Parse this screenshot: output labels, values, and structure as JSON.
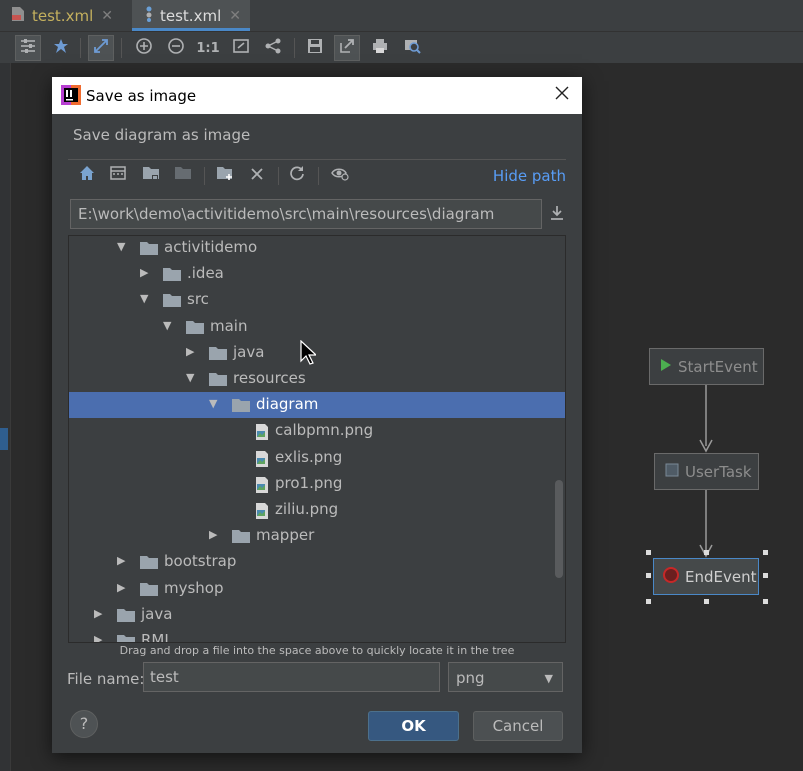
{
  "tabs": [
    {
      "label": "test.xml",
      "active": false
    },
    {
      "label": "test.xml",
      "active": true
    }
  ],
  "toolbar": {
    "icons": [
      "settings-icon",
      "pin-icon",
      "fit-icon",
      "zoom-in-icon",
      "zoom-out-icon",
      "actual-size-icon",
      "zoom-region-icon",
      "share-icon",
      "save-icon",
      "export-icon",
      "print-icon",
      "inspect-icon"
    ],
    "actual_size_label": "1:1"
  },
  "diagram": {
    "nodes": [
      {
        "label": "StartEvent"
      },
      {
        "label": "UserTask"
      },
      {
        "label": "EndEvent"
      }
    ],
    "colors": {
      "start": "#4caf50",
      "end": "#c62828"
    }
  },
  "dialog": {
    "title": "Save as image",
    "subtitle": "Save diagram as image",
    "hide_path_label": "Hide path",
    "path_value": "E:\\work\\demo\\activitidemo\\src\\main\\resources\\diagram",
    "tree": [
      {
        "label": "activitidemo",
        "expanded": true,
        "type": "folder"
      },
      {
        "label": ".idea",
        "expanded": false,
        "type": "folder"
      },
      {
        "label": "src",
        "expanded": true,
        "type": "folder"
      },
      {
        "label": "main",
        "expanded": true,
        "type": "folder"
      },
      {
        "label": "java",
        "expanded": false,
        "type": "folder"
      },
      {
        "label": "resources",
        "expanded": true,
        "type": "folder"
      },
      {
        "label": "diagram",
        "expanded": true,
        "type": "folder",
        "selected": true
      },
      {
        "label": "calbpmn.png",
        "type": "file"
      },
      {
        "label": "exlis.png",
        "type": "file"
      },
      {
        "label": "pro1.png",
        "type": "file"
      },
      {
        "label": "ziliu.png",
        "type": "file"
      },
      {
        "label": "mapper",
        "expanded": false,
        "type": "folder"
      },
      {
        "label": "bootstrap",
        "expanded": false,
        "type": "folder"
      },
      {
        "label": "myshop",
        "expanded": false,
        "type": "folder"
      },
      {
        "label": "java",
        "expanded": false,
        "type": "folder"
      },
      {
        "label": "RMI",
        "expanded": false,
        "type": "folder"
      }
    ],
    "hint": "Drag and drop a file into the space above to quickly locate it in the tree",
    "file_name_label": "File name:",
    "file_name_value": "test",
    "format_value": "png",
    "ok_label": "OK",
    "cancel_label": "Cancel",
    "help_label": "?"
  },
  "colors": {
    "accent": "#4b6eaf",
    "link": "#589df6",
    "ok": "#365880"
  }
}
